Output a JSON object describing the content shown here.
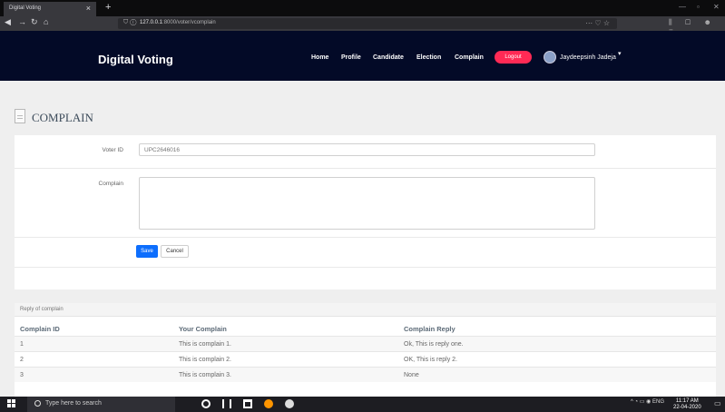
{
  "browser": {
    "tab_title": "Digital Voting",
    "tab_close": "×",
    "new_tab": "+",
    "url_host": "127.0.0.1",
    "url_path": ":8000/voter/vcomplain",
    "url_actions": "··· ♡ ☆",
    "toolbar_right": "⫼ ▢ ☻ ≡",
    "win_min": "—",
    "win_max": "▫",
    "win_close": "✕"
  },
  "header": {
    "brand": "Digital Voting",
    "menu": [
      "Home",
      "Profile",
      "Candidate",
      "Election",
      "Complain"
    ],
    "logout_label": "Logout",
    "username": "Jaydeepsinh Jadeja",
    "caret": "▾"
  },
  "page": {
    "title": "COMPLAIN"
  },
  "form": {
    "voter_id_label": "Voter ID",
    "voter_id_value": "UPC2646016",
    "complain_label": "Complain",
    "complain_value": "",
    "save_label": "Save",
    "cancel_label": "Cancel"
  },
  "replies": {
    "panel_title": "Reply of complain",
    "columns": [
      "Complain ID",
      "Your Complain",
      "Complain Reply"
    ],
    "rows": [
      [
        "1",
        "This is complain 1.",
        "Ok, This is reply one."
      ],
      [
        "2",
        "This is complain 2.",
        "OK, This is reply 2."
      ],
      [
        "3",
        "This is complain 3.",
        "None"
      ]
    ]
  },
  "taskbar": {
    "search_placeholder": "Type here to search",
    "tray_lang": "ENG",
    "time": "11:17 AM",
    "date": "22-04-2020"
  },
  "colors": {
    "header_bg": "#030a27",
    "logout_bg": "#ff2a55",
    "save_bg": "#0d6efd"
  }
}
